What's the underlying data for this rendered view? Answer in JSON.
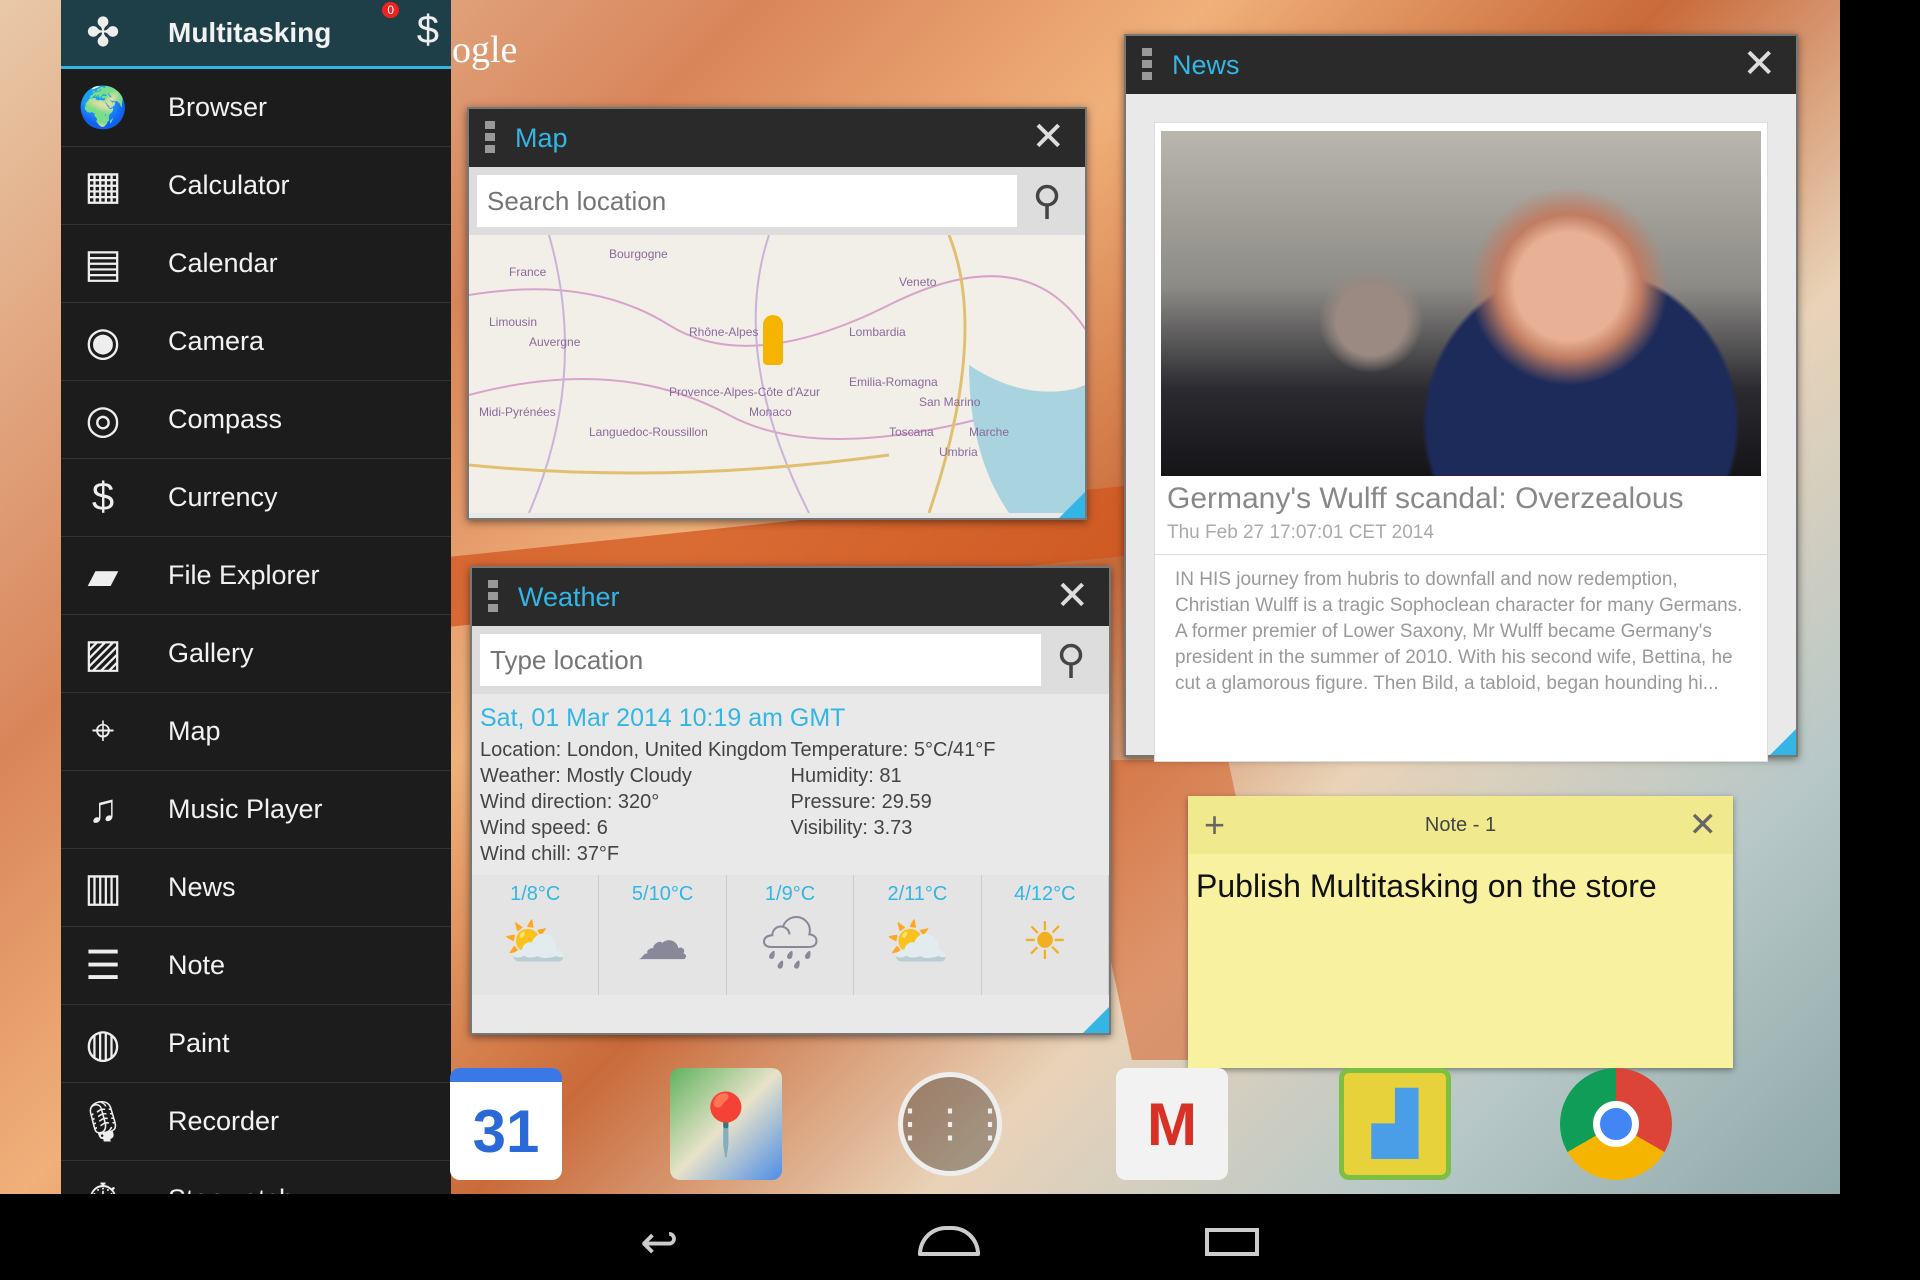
{
  "sidebar": {
    "header": {
      "label": "Multitasking",
      "badge": "0"
    },
    "items": [
      {
        "label": "Browser",
        "icon": "globe-icon"
      },
      {
        "label": "Calculator",
        "icon": "calculator-icon"
      },
      {
        "label": "Calendar",
        "icon": "calendar-icon"
      },
      {
        "label": "Camera",
        "icon": "camera-icon"
      },
      {
        "label": "Compass",
        "icon": "compass-icon"
      },
      {
        "label": "Currency",
        "icon": "currency-icon"
      },
      {
        "label": "File Explorer",
        "icon": "folder-icon"
      },
      {
        "label": "Gallery",
        "icon": "gallery-icon"
      },
      {
        "label": "Map",
        "icon": "map-icon"
      },
      {
        "label": "Music Player",
        "icon": "music-icon"
      },
      {
        "label": "News",
        "icon": "news-icon"
      },
      {
        "label": "Note",
        "icon": "note-icon"
      },
      {
        "label": "Paint",
        "icon": "palette-icon"
      },
      {
        "label": "Recorder",
        "icon": "microphone-icon"
      },
      {
        "label": "Stopwatch",
        "icon": "stopwatch-icon"
      }
    ]
  },
  "wallpaper_text": "ogle",
  "map": {
    "title": "Map",
    "search_placeholder": "Search location",
    "labels": [
      "France",
      "Bourgogne",
      "Limousin",
      "Auvergne",
      "Rhône-Alpes",
      "Lombardia",
      "Veneto",
      "Emilia-Romagna",
      "Provence-Alpes-Côte d'Azur",
      "Monaco",
      "San Marino",
      "Toscana",
      "Marche",
      "Umbria",
      "Languedoc-Roussillon",
      "Midi-Pyrénées"
    ]
  },
  "weather": {
    "title": "Weather",
    "search_placeholder": "Type location",
    "date": "Sat, 01 Mar 2014 10:19 am GMT",
    "left": [
      "Location: London, United Kingdom",
      "Weather: Mostly Cloudy",
      "Wind direction: 320°",
      "Wind speed: 6",
      "Wind chill: 37°F"
    ],
    "right": [
      "Temperature: 5°C/41°F",
      "Humidity: 81",
      "Pressure: 29.59",
      "Visibility: 3.73"
    ],
    "forecast": [
      {
        "temp": "1/8°C",
        "icon": "partly-cloudy-icon"
      },
      {
        "temp": "5/10°C",
        "icon": "cloudy-icon"
      },
      {
        "temp": "1/9°C",
        "icon": "rain-icon"
      },
      {
        "temp": "2/11°C",
        "icon": "partly-cloudy-icon"
      },
      {
        "temp": "4/12°C",
        "icon": "sunny-icon"
      }
    ]
  },
  "news": {
    "title": "News",
    "headline": "Germany's Wulff scandal: Overzealous",
    "date": "Thu Feb 27 17:07:01 CET 2014",
    "body": "IN HIS journey from hubris to downfall and now redemption, Christian Wulff is a tragic Sophoclean character for many Germans. A former premier of Lower Saxony, Mr Wulff became Germany's president in the summer of 2010. With his second wife, Bettina, he cut a glamorous figure. Then Bild, a tabloid, began hounding hi..."
  },
  "note": {
    "title": "Note - 1",
    "text": "Publish Multitasking on the store"
  },
  "dock": [
    {
      "name": "calendar-app",
      "label": "31"
    },
    {
      "name": "maps-app"
    },
    {
      "name": "app-drawer"
    },
    {
      "name": "gmail-app"
    },
    {
      "name": "multitasking-app"
    },
    {
      "name": "chrome-app"
    }
  ],
  "colors": {
    "accent": "#33b5e5",
    "note": "#f7f1a0"
  }
}
